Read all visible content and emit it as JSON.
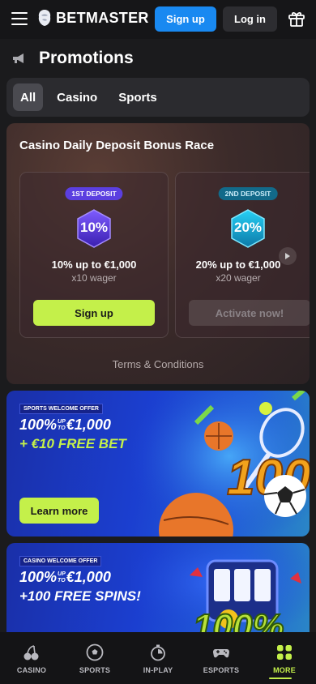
{
  "header": {
    "brand": "BETMASTER",
    "signup_label": "Sign up",
    "login_label": "Log in",
    "menu_icon": "hamburger-icon",
    "gift_icon": "gift-icon"
  },
  "page": {
    "title": "Promotions",
    "title_icon": "megaphone-icon"
  },
  "tabs": [
    {
      "label": "All",
      "active": true
    },
    {
      "label": "Casino",
      "active": false
    },
    {
      "label": "Sports",
      "active": false
    }
  ],
  "race": {
    "title": "Casino Daily Deposit Bonus Race",
    "deposits": [
      {
        "tag": "1ST DEPOSIT",
        "percent": "10%",
        "headline": "10% up to €1,000",
        "wager": "x10 wager",
        "button": "Sign up"
      },
      {
        "tag": "2ND DEPOSIT",
        "percent": "20%",
        "headline": "20% up to €1,000",
        "wager": "x20 wager",
        "button": "Activate now!"
      }
    ],
    "terms": "Terms & Conditions"
  },
  "banners": [
    {
      "tag": "SPORTS WELCOME OFFER",
      "line1_a": "100%",
      "upto_1": "UP",
      "upto_2": "TO",
      "line1_b": "€1,000",
      "line2": "+ €10 FREE BET",
      "button": "Learn more",
      "art_text": "100%"
    },
    {
      "tag": "CASINO WELCOME OFFER",
      "line1_a": "100%",
      "upto_1": "UP",
      "upto_2": "TO",
      "line1_b": "€1,000",
      "line2": "+100 FREE SPINS!",
      "art_text": "100%"
    }
  ],
  "bottom_nav": [
    {
      "label": "CASINO",
      "icon": "cherries-icon",
      "active": false
    },
    {
      "label": "SPORTS",
      "icon": "soccer-ball-icon",
      "active": false
    },
    {
      "label": "IN-PLAY",
      "icon": "stopwatch-icon",
      "active": false
    },
    {
      "label": "ESPORTS",
      "icon": "gamepad-icon",
      "active": false
    },
    {
      "label": "MORE",
      "icon": "grid-icon",
      "active": true
    }
  ],
  "colors": {
    "accent_green": "#c4f04a",
    "brand_blue": "#1989f1",
    "background": "#1b1b1d"
  }
}
